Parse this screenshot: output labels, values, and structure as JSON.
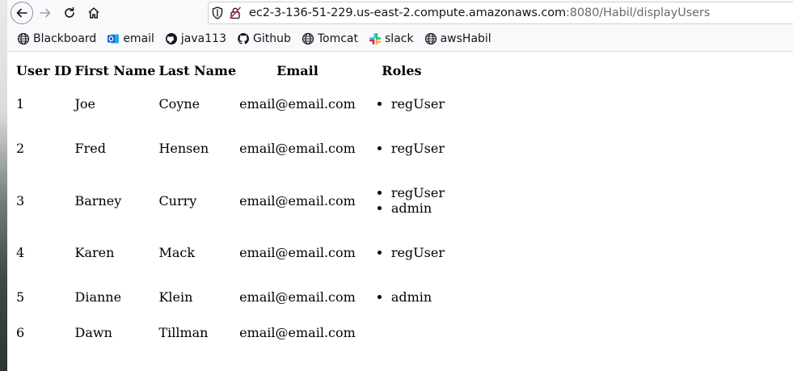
{
  "browser": {
    "url_host": "ec2-3-136-51-229.us-east-2.compute.amazonaws.com",
    "url_rest": ":8080/Habil/displayUsers"
  },
  "bookmarks": [
    {
      "label": "Blackboard",
      "icon": "globe-icon"
    },
    {
      "label": "email",
      "icon": "outlook-icon"
    },
    {
      "label": "java113",
      "icon": "github-icon"
    },
    {
      "label": "Github",
      "icon": "github-icon"
    },
    {
      "label": "Tomcat",
      "icon": "globe-icon"
    },
    {
      "label": "slack",
      "icon": "slack-icon"
    },
    {
      "label": "awsHabil",
      "icon": "globe-icon"
    }
  ],
  "table": {
    "headers": [
      "User ID",
      "First Name",
      "Last Name",
      "Email",
      "Roles"
    ],
    "rows": [
      {
        "id": "1",
        "first": "Joe",
        "last": "Coyne",
        "email": "email@email.com",
        "roles": [
          "regUser"
        ]
      },
      {
        "id": "2",
        "first": "Fred",
        "last": "Hensen",
        "email": "email@email.com",
        "roles": [
          "regUser"
        ]
      },
      {
        "id": "3",
        "first": "Barney",
        "last": "Curry",
        "email": "email@email.com",
        "roles": [
          "regUser",
          "admin"
        ]
      },
      {
        "id": "4",
        "first": "Karen",
        "last": "Mack",
        "email": "email@email.com",
        "roles": [
          "regUser"
        ]
      },
      {
        "id": "5",
        "first": "Dianne",
        "last": "Klein",
        "email": "email@email.com",
        "roles": [
          "admin"
        ]
      },
      {
        "id": "6",
        "first": "Dawn",
        "last": "Tillman",
        "email": "email@email.com",
        "roles": []
      }
    ]
  },
  "colors": {
    "toolbar_bg": "#f9f9fb",
    "slack_red": "#e01e5a",
    "slack_green": "#2eb67d",
    "slack_blue": "#36c5f0",
    "slack_yellow": "#ecb22e",
    "outlook_blue": "#0a64c8",
    "insecure_red": "#e22850"
  }
}
